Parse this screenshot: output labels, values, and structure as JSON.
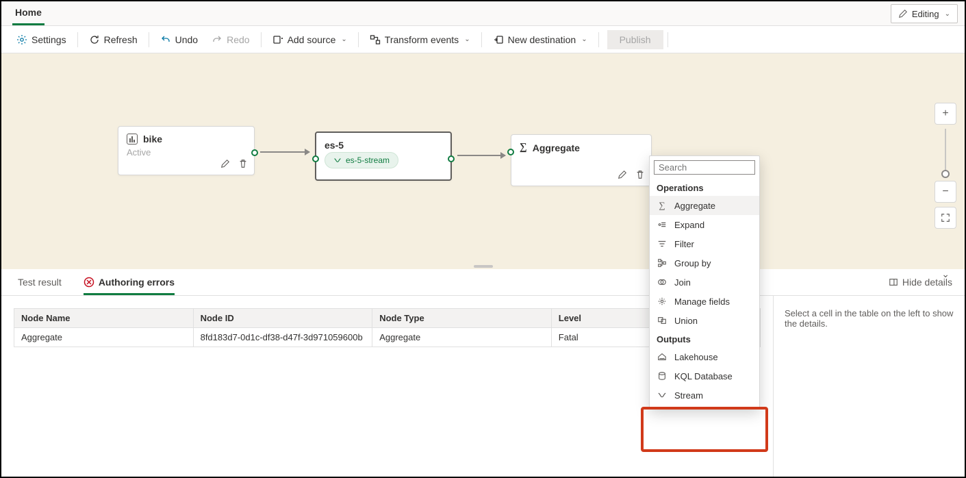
{
  "tabs": {
    "home": "Home"
  },
  "mode": {
    "label": "Editing"
  },
  "toolbar": {
    "settings": "Settings",
    "refresh": "Refresh",
    "undo": "Undo",
    "redo": "Redo",
    "add_source": "Add source",
    "transform": "Transform events",
    "new_dest": "New destination",
    "publish": "Publish"
  },
  "nodes": {
    "bike": {
      "title": "bike",
      "status": "Active"
    },
    "es5": {
      "title": "es-5",
      "pill": "es-5-stream"
    },
    "aggregate": {
      "title": "Aggregate"
    }
  },
  "popover": {
    "search_placeholder": "Search",
    "section_ops": "Operations",
    "section_out": "Outputs",
    "items": {
      "aggregate": "Aggregate",
      "expand": "Expand",
      "filter": "Filter",
      "groupby": "Group by",
      "join": "Join",
      "manage": "Manage fields",
      "union": "Union",
      "lake": "Lakehouse",
      "kql": "KQL Database",
      "stream": "Stream"
    }
  },
  "panel": {
    "tab_test": "Test result",
    "tab_errors": "Authoring errors",
    "hide": "Hide details",
    "detail_msg": "Select a cell in the table on the left to show the details.",
    "cols": {
      "name": "Node Name",
      "id": "Node ID",
      "type": "Node Type",
      "level": "Level"
    },
    "row": {
      "name": "Aggregate",
      "id": "8fd183d7-0d1c-df38-d47f-3d971059600b",
      "type": "Aggregate",
      "level": "Fatal"
    }
  }
}
